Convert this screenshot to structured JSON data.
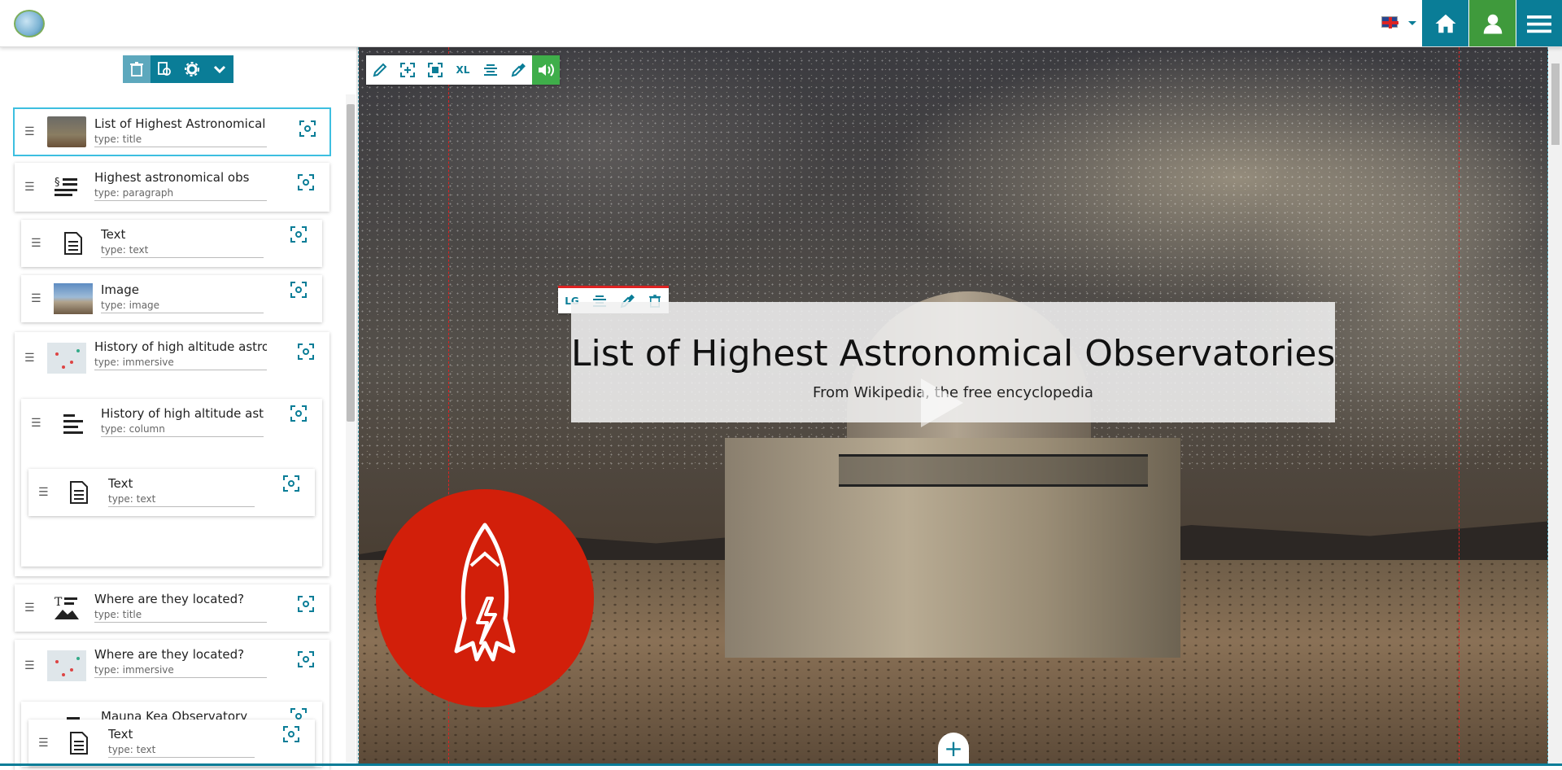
{
  "header": {
    "logo_name": "globe-logo",
    "language": "English",
    "nav": [
      "home-icon",
      "user-icon",
      "menu-icon"
    ],
    "colors": {
      "primary": "#0a7d97",
      "secondary": "#3f9a3c"
    }
  },
  "sidebar": {
    "toolbar": [
      "trash-icon",
      "preview-icon",
      "gear-icon",
      "chevron-down-icon"
    ],
    "nodes": [
      {
        "title": "List of Highest Astronomical O",
        "type": "type: title"
      },
      {
        "title": "Highest astronomical obs",
        "type": "type: paragraph"
      },
      {
        "title": "Text",
        "type": "type: text"
      },
      {
        "title": "Image",
        "type": "type: image"
      },
      {
        "title": "History of high altitude astronc",
        "type": "type: immersive"
      },
      {
        "title": "History of high altitude astrc",
        "type": "type: column"
      },
      {
        "title": "Text",
        "type": "type: text"
      },
      {
        "title": "Where are they located?",
        "type": "type: title"
      },
      {
        "title": "Where are they located?",
        "type": "type: immersive"
      },
      {
        "title": "Mauna Kea Observatory",
        "type": "type: column"
      },
      {
        "title": "Text",
        "type": "type: text"
      }
    ]
  },
  "canvas_toolbar": {
    "size_label": "XL"
  },
  "title_toolbar": {
    "size_label": "LG"
  },
  "hero": {
    "title": "List of Highest Astronomical Observatories",
    "subtitle": "From Wikipedia, the free encyclopedia"
  },
  "add_label": "+"
}
